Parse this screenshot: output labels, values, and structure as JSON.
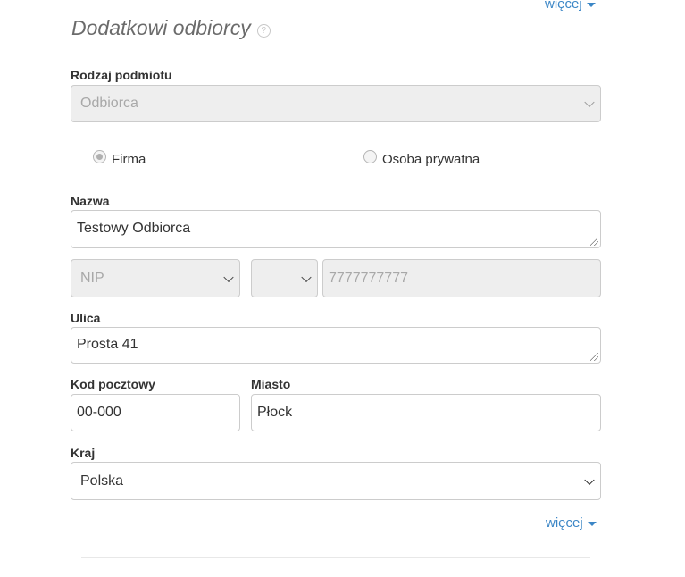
{
  "top_more_label": "więcej",
  "section": {
    "title": "Dodatkowi odbiorcy",
    "help_glyph": "?"
  },
  "entity_type": {
    "label": "Rodzaj podmiotu",
    "selected": "Odbiorca"
  },
  "radio_options": [
    {
      "label": "Firma",
      "checked": true
    },
    {
      "label": "Osoba prywatna",
      "checked": false
    }
  ],
  "name_field": {
    "label": "Nazwa",
    "value": "Testowy Odbiorca"
  },
  "tax_id": {
    "type_selected": "NIP",
    "prefix_selected": "",
    "value": "7777777777"
  },
  "street_field": {
    "label": "Ulica",
    "value": "Prosta 41"
  },
  "postal_code": {
    "label": "Kod pocztowy",
    "value": "00-000"
  },
  "city": {
    "label": "Miasto",
    "value": "Płock"
  },
  "country": {
    "label": "Kraj",
    "selected": "Polska"
  },
  "bottom_more_label": "więcej",
  "colors": {
    "link": "#3b86c6",
    "disabled_bg": "#eeeeee",
    "border": "#cccccc"
  }
}
